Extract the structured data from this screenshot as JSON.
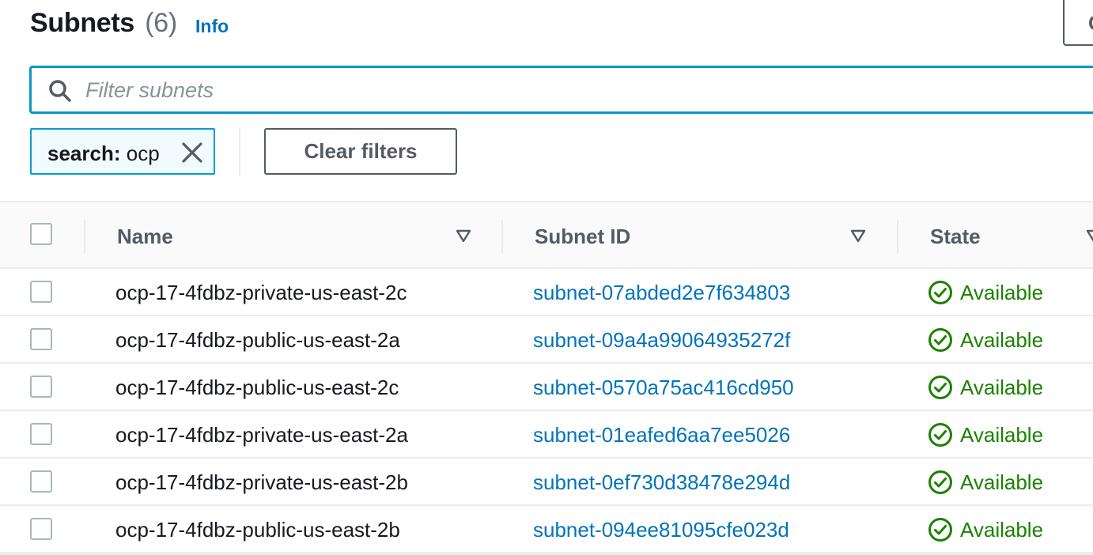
{
  "header": {
    "title": "Subnets",
    "count": "(6)",
    "info_label": "Info"
  },
  "search": {
    "placeholder": "Filter subnets",
    "value": ""
  },
  "filter_token": {
    "key": "search:",
    "value": "ocp"
  },
  "clear_filters_label": "Clear filters",
  "columns": {
    "name": "Name",
    "subnet_id": "Subnet ID",
    "state": "State"
  },
  "rows": [
    {
      "name": "ocp-17-4fdbz-private-us-east-2c",
      "subnet_id": "subnet-07abded2e7f634803",
      "state": "Available"
    },
    {
      "name": "ocp-17-4fdbz-public-us-east-2a",
      "subnet_id": "subnet-09a4a99064935272f",
      "state": "Available"
    },
    {
      "name": "ocp-17-4fdbz-public-us-east-2c",
      "subnet_id": "subnet-0570a75ac416cd950",
      "state": "Available"
    },
    {
      "name": "ocp-17-4fdbz-private-us-east-2a",
      "subnet_id": "subnet-01eafed6aa7ee5026",
      "state": "Available"
    },
    {
      "name": "ocp-17-4fdbz-private-us-east-2b",
      "subnet_id": "subnet-0ef730d38478e294d",
      "state": "Available"
    },
    {
      "name": "ocp-17-4fdbz-public-us-east-2b",
      "subnet_id": "subnet-094ee81095cfe023d",
      "state": "Available"
    }
  ],
  "colors": {
    "link": "#0073bb",
    "available": "#1d8102",
    "focus": "#0a97c7"
  },
  "icons": {
    "search": "search-icon",
    "token_close": "close-icon",
    "sort": "sort-down-icon",
    "state": "check-circle-icon"
  }
}
